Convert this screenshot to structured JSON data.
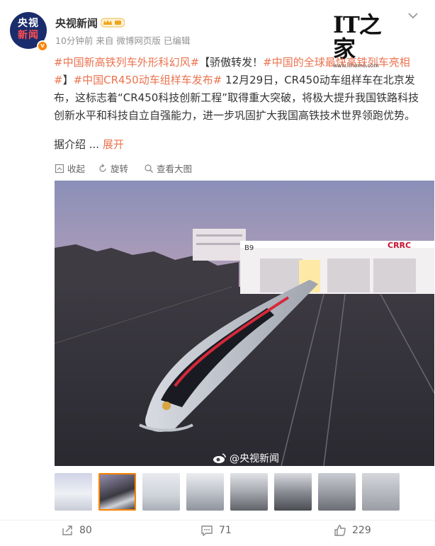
{
  "post": {
    "author": "央视新闻",
    "avatar_text": [
      "央视",
      "新闻"
    ],
    "avatar_badge": "v",
    "meta": "10分钟前  来自 微博网页版 已编辑",
    "source_logo_text": "IT之家",
    "source_url": "www.ithome.com",
    "text": {
      "tag1": "#中国新高铁列车外形科幻风#",
      "plain1": "【骄傲转发！",
      "tag2": "#中国的全球最快高铁列车亮相#",
      "plain2": "】",
      "tag3": "#中国CR450动车组样车发布#",
      "body": " 12月29日，CR450动车组样车在北京发布，这标志着“CR450科技创新工程”取得重大突破，将极大提升我国铁路科技创新水平和科技自立自强能力，进一步巩固扩大我国高铁技术世界领跑优势。"
    },
    "expand_prefix": "据介绍 ...",
    "expand_label": "展开"
  },
  "toolbar": {
    "collapse": "收起",
    "rotate": "旋转",
    "view_large": "查看大图"
  },
  "image": {
    "building_label": "B9",
    "brand": "CRRC",
    "watermark": "@央视新闻",
    "thumb_count": 8,
    "selected_thumb": 2
  },
  "actions": {
    "repost": "80",
    "comment": "71",
    "like": "229"
  },
  "colors": {
    "tag": "#eb7350",
    "accent": "#ff8200"
  }
}
